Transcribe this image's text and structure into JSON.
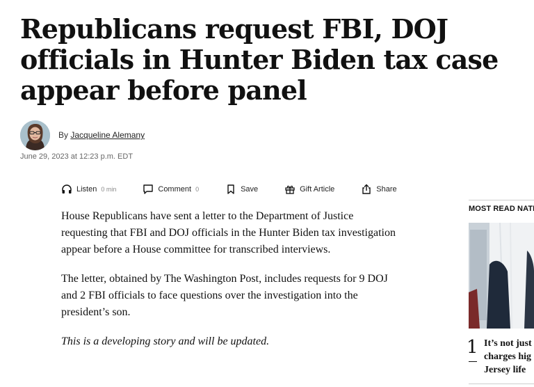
{
  "article": {
    "headline": "Republicans request FBI, DOJ officials in Hunter Biden tax case appear before panel",
    "byline_prefix": "By",
    "author": "Jacqueline Alemany",
    "date": "June 29, 2023 at 12:23 p.m. EDT",
    "paragraphs": [
      "House Republicans have sent a letter to the Department of Justice requesting that FBI and DOJ officials in the Hunter Biden tax investigation appear before a House committee for transcribed interviews.",
      "The letter, obtained by The Washington Post, includes requests for 9 DOJ and 2 FBI officials to face questions over the investigation into the president’s son."
    ],
    "italic_note": "This is a developing story and will be updated."
  },
  "toolbar": {
    "listen": {
      "label": "Listen",
      "meta": "0 min",
      "icon": "headphones-icon"
    },
    "comment": {
      "label": "Comment",
      "meta": "0",
      "icon": "comment-icon"
    },
    "save": {
      "label": "Save",
      "icon": "bookmark-icon"
    },
    "gift": {
      "label": "Gift Article",
      "icon": "gift-icon"
    },
    "share": {
      "label": "Share",
      "icon": "share-icon"
    }
  },
  "rail": {
    "title": "MOST READ NATI",
    "item_number": "1",
    "item_headline": "It’s not just\ncharges hig\nJersey life"
  }
}
